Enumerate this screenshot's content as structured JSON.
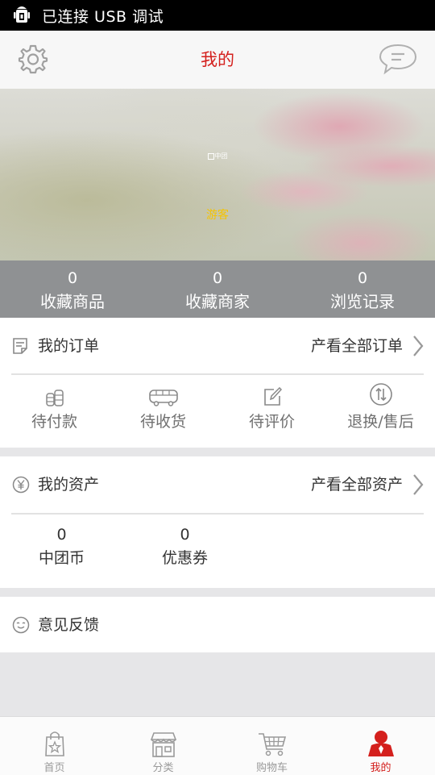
{
  "status_bar": {
    "text": "已连接 USB 调试",
    "icon": "android-usb-icon"
  },
  "header": {
    "title": "我的",
    "left_icon": "gear-icon",
    "right_icon": "message-icon"
  },
  "banner": {
    "logo_text": "中团",
    "username": "游客"
  },
  "stats": [
    {
      "count": "0",
      "label": "收藏商品"
    },
    {
      "count": "0",
      "label": "收藏商家"
    },
    {
      "count": "0",
      "label": "浏览记录"
    }
  ],
  "orders": {
    "title": "我的订单",
    "link": "产看全部订单",
    "items": [
      {
        "label": "待付款",
        "icon": "coins-icon"
      },
      {
        "label": "待收货",
        "icon": "truck-icon"
      },
      {
        "label": "待评价",
        "icon": "edit-icon"
      },
      {
        "label": "退换/售后",
        "icon": "exchange-icon"
      }
    ]
  },
  "assets": {
    "title": "我的资产",
    "link": "产看全部资产",
    "items": [
      {
        "value": "0",
        "label": "中团币"
      },
      {
        "value": "0",
        "label": "优惠券"
      }
    ]
  },
  "feedback": {
    "label": "意见反馈"
  },
  "tabs": [
    {
      "label": "首页",
      "icon": "shopping-bag-icon",
      "active": false
    },
    {
      "label": "分类",
      "icon": "store-icon",
      "active": false
    },
    {
      "label": "购物车",
      "icon": "cart-icon",
      "active": false
    },
    {
      "label": "我的",
      "icon": "user-icon",
      "active": true
    }
  ],
  "colors": {
    "accent": "#d4201d",
    "stats_bg": "#8f9193",
    "guest_text": "#f5c400"
  }
}
